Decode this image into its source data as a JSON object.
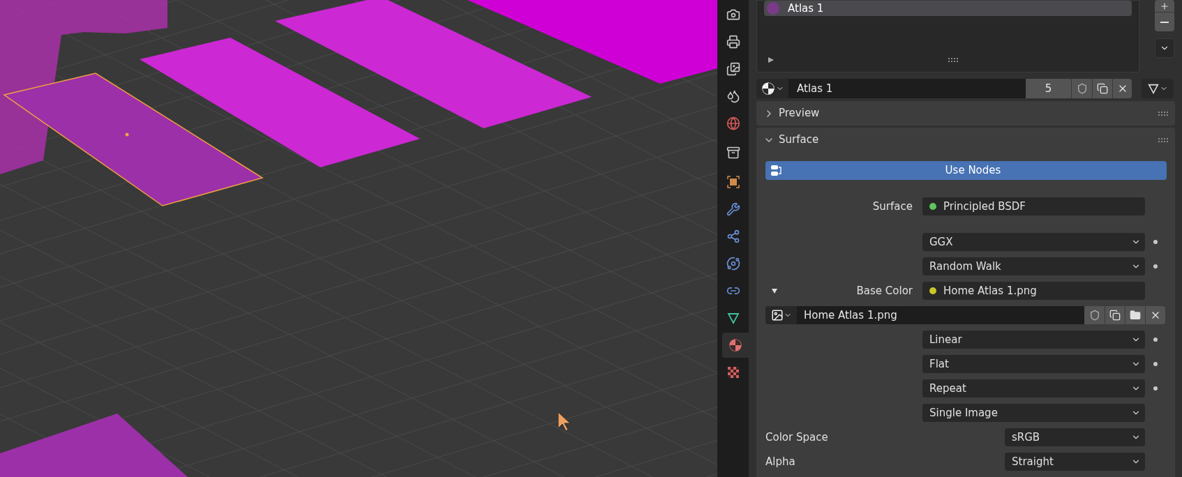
{
  "property_tabs": [
    {
      "kind": "render",
      "selected": false
    },
    {
      "kind": "output",
      "selected": false
    },
    {
      "kind": "viewlayer",
      "selected": false
    },
    {
      "kind": "scene",
      "selected": false
    },
    {
      "kind": "world",
      "selected": false
    },
    {
      "kind": "collection",
      "selected": false
    },
    {
      "kind": "object",
      "selected": false
    },
    {
      "kind": "modifiers",
      "selected": false
    },
    {
      "kind": "particles",
      "selected": false
    },
    {
      "kind": "physics",
      "selected": false
    },
    {
      "kind": "constraints",
      "selected": false
    },
    {
      "kind": "data",
      "selected": false
    },
    {
      "kind": "material",
      "selected": true
    },
    {
      "kind": "texture",
      "selected": false
    }
  ],
  "material_slots": [
    {
      "name": "Atlas 1",
      "selected": true
    }
  ],
  "material": {
    "name": "Atlas 1",
    "users": "5"
  },
  "panels": [
    {
      "title": "Preview",
      "expanded": false
    },
    {
      "title": "Surface",
      "expanded": true
    }
  ],
  "use_nodes": {
    "label": "Use Nodes",
    "on": true
  },
  "rows": [
    {
      "kind": "socket",
      "label": "Surface",
      "value": "Principled BSDF",
      "color": "#5fc45f"
    },
    {
      "kind": "dropdown",
      "value": "GGX",
      "dot": true
    },
    {
      "kind": "dropdown",
      "value": "Random Walk",
      "dot": true
    },
    {
      "kind": "socket",
      "label": "Base Color",
      "value": "Home Atlas 1.png",
      "color": "#c7c729",
      "expanded": true
    },
    {
      "kind": "image",
      "value": "Home Atlas 1.png"
    },
    {
      "kind": "dropdown",
      "value": "Linear",
      "dot": true
    },
    {
      "kind": "dropdown",
      "value": "Flat",
      "dot": true
    },
    {
      "kind": "dropdown",
      "value": "Repeat",
      "dot": true
    },
    {
      "kind": "dropdown",
      "value": "Single Image",
      "dot": false
    },
    {
      "kind": "wide",
      "label": "Color Space",
      "value": "sRGB"
    },
    {
      "kind": "wide",
      "label": "Alpha",
      "value": "Straight"
    }
  ]
}
